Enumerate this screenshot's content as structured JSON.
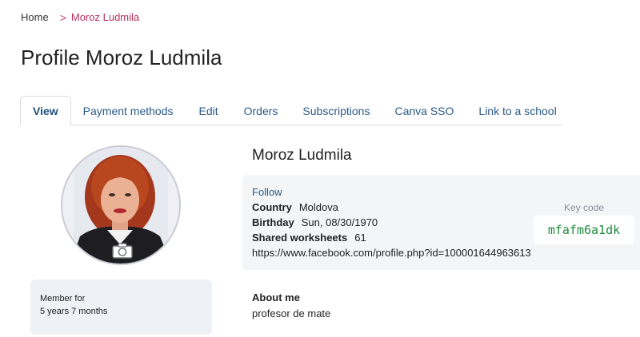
{
  "breadcrumb": {
    "home": "Home",
    "separator": ">",
    "current": "Moroz Ludmila"
  },
  "page_title": "Profile Moroz Ludmila",
  "tabs": [
    {
      "label": "View",
      "active": true
    },
    {
      "label": "Payment methods"
    },
    {
      "label": "Edit"
    },
    {
      "label": "Orders"
    },
    {
      "label": "Subscriptions"
    },
    {
      "label": "Canva SSO"
    },
    {
      "label": "Link to a school"
    }
  ],
  "profile": {
    "name": "Moroz Ludmila",
    "follow_label": "Follow",
    "country_label": "Country",
    "country": "Moldova",
    "birthday_label": "Birthday",
    "birthday": "Sun, 08/30/1970",
    "shared_label": "Shared worksheets",
    "shared_count": "61",
    "facebook_url": "https://www.facebook.com/profile.php?id=100001644963613",
    "key_code_label": "Key code",
    "key_code": "mfafm6a1dk"
  },
  "member": {
    "label": "Member for",
    "duration": "5 years 7 months"
  },
  "about": {
    "title": "About me",
    "text": "profesor de mate"
  },
  "colors": {
    "link": "#2b5a87",
    "breadcrumb_current": "#b8325c",
    "key_code": "#1e8a3c",
    "panel": "#f3f5f7"
  }
}
